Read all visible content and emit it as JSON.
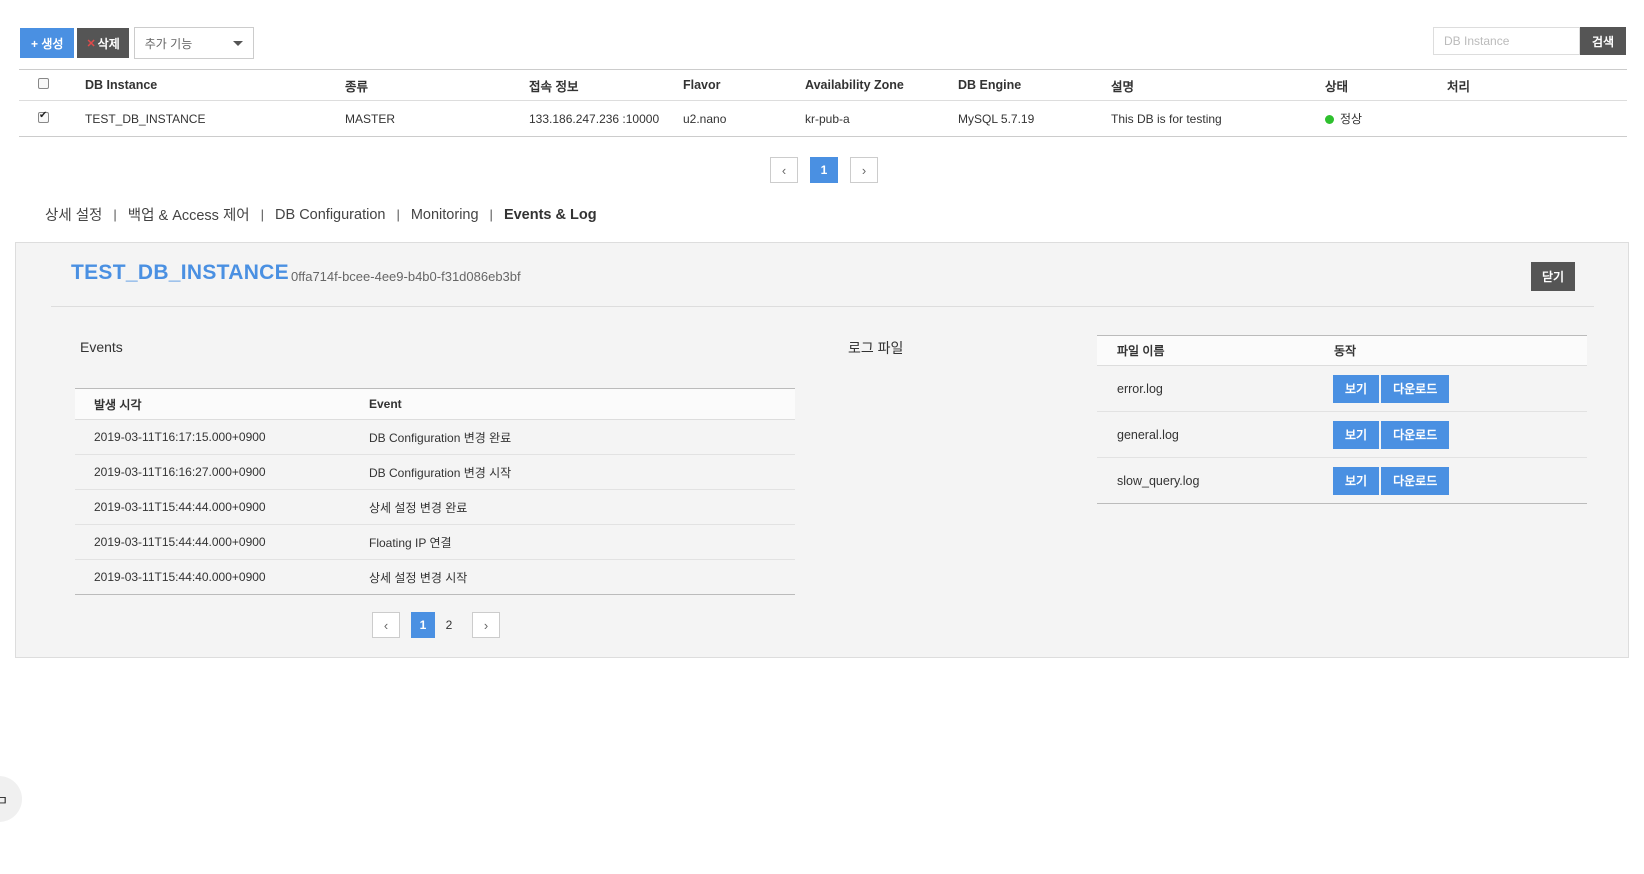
{
  "toolbar": {
    "create_label": "+ 생성",
    "delete_label": "삭제",
    "delete_icon": "x-icon",
    "extra_select": "추가 기능"
  },
  "search": {
    "placeholder": "DB Instance",
    "button_label": "검색"
  },
  "instance_table": {
    "headers": [
      "DB Instance",
      "종류",
      "접속 정보",
      "Flavor",
      "Availability Zone",
      "DB Engine",
      "설명",
      "상태",
      "처리"
    ],
    "rows": [
      {
        "checked": true,
        "name": "TEST_DB_INSTANCE",
        "type": "MASTER",
        "connection": "133.186.247.236 :10000",
        "flavor": "u2.nano",
        "zone": "kr-pub-a",
        "engine": "MySQL 5.7.19",
        "description": "This DB is for testing",
        "status": "정상",
        "status_color": "#2ec02e",
        "action": ""
      }
    ]
  },
  "instance_pager": {
    "prev": "‹",
    "pages": [
      "1"
    ],
    "active": "1",
    "next": "›"
  },
  "tabs": [
    {
      "label": "상세 설정",
      "active": false
    },
    {
      "label": "백업 & Access 제어",
      "active": false
    },
    {
      "label": "DB Configuration",
      "active": false
    },
    {
      "label": "Monitoring",
      "active": false
    },
    {
      "label": "Events & Log",
      "active": true
    }
  ],
  "tab_separator": "|",
  "detail": {
    "title": "TEST_DB_INSTANCE",
    "instance_id": "0ffa714f-bcee-4ee9-b4b0-f31d086eb3bf",
    "close_label": "닫기",
    "events_label": "Events",
    "events_headers": [
      "발생 시각",
      "Event"
    ],
    "events": [
      {
        "time": "2019-03-11T16:17:15.000+0900",
        "event": "DB Configuration 변경 완료"
      },
      {
        "time": "2019-03-11T16:16:27.000+0900",
        "event": "DB Configuration 변경 시작"
      },
      {
        "time": "2019-03-11T15:44:44.000+0900",
        "event": "상세 설정 변경 완료"
      },
      {
        "time": "2019-03-11T15:44:44.000+0900",
        "event": "Floating IP 연결"
      },
      {
        "time": "2019-03-11T15:44:40.000+0900",
        "event": "상세 설정 변경 시작"
      }
    ],
    "events_pager": {
      "prev": "‹",
      "pages": [
        "1",
        "2"
      ],
      "active": "1",
      "next": "›"
    },
    "log_label": "로그 파일",
    "log_headers": [
      "파일 이름",
      "동작"
    ],
    "logs": [
      {
        "file": "error.log",
        "view": "보기",
        "download": "다운로드"
      },
      {
        "file": "general.log",
        "view": "보기",
        "download": "다운로드"
      },
      {
        "file": "slow_query.log",
        "view": "보기",
        "download": "다운로드"
      }
    ]
  },
  "floating": {
    "glyph": "ㅁ"
  },
  "colors": {
    "accent": "#4a90e2",
    "dark_button": "#555555",
    "panel_bg": "#f4f4f4",
    "status_ok": "#2ec02e"
  }
}
